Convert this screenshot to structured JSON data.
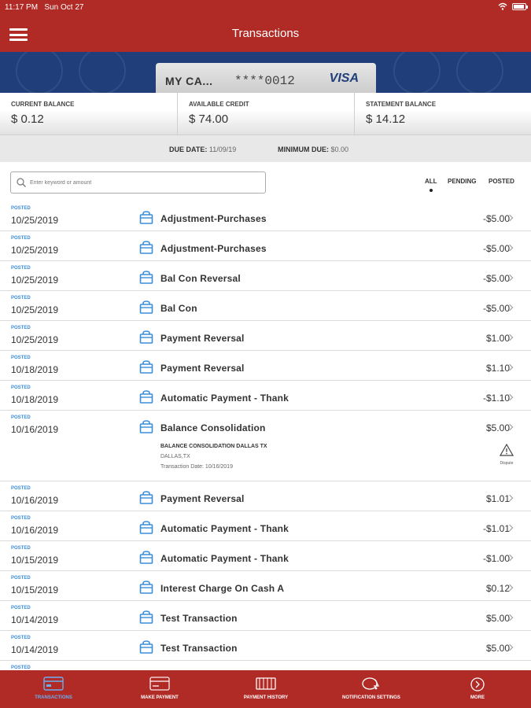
{
  "status_bar": {
    "time": "11:17 PM",
    "date": "Sun Oct 27"
  },
  "header": {
    "title": "Transactions"
  },
  "card": {
    "name": "MY CA...",
    "number": "****0012",
    "network": "VISA"
  },
  "balances": [
    {
      "label": "CURRENT BALANCE",
      "value": "$ 0.12"
    },
    {
      "label": "AVAILABLE CREDIT",
      "value": "$ 74.00"
    },
    {
      "label": "STATEMENT BALANCE",
      "value": "$ 14.12"
    }
  ],
  "due": {
    "due_label": "DUE DATE:",
    "due_value": "11/09/19",
    "min_label": "MINIMUM DUE:",
    "min_value": "$0.00"
  },
  "search": {
    "placeholder": "Enter keyword or amount"
  },
  "filters": {
    "all": "ALL",
    "pending": "PENDING",
    "posted": "POSTED",
    "selected": "ALL"
  },
  "transactions": [
    {
      "status": "POSTED",
      "date": "10/25/2019",
      "description": "Adjustment-Purchases",
      "amount": "-$5.00"
    },
    {
      "status": "POSTED",
      "date": "10/25/2019",
      "description": "Adjustment-Purchases",
      "amount": "-$5.00"
    },
    {
      "status": "POSTED",
      "date": "10/25/2019",
      "description": "Bal Con Reversal",
      "amount": "-$5.00"
    },
    {
      "status": "POSTED",
      "date": "10/25/2019",
      "description": "Bal Con",
      "amount": "-$5.00"
    },
    {
      "status": "POSTED",
      "date": "10/25/2019",
      "description": "Payment Reversal",
      "amount": "$1.00"
    },
    {
      "status": "POSTED",
      "date": "10/18/2019",
      "description": "Payment Reversal",
      "amount": "$1.10"
    },
    {
      "status": "POSTED",
      "date": "10/18/2019",
      "description": "Automatic Payment - Thank",
      "amount": "-$1.10"
    },
    {
      "status": "POSTED",
      "date": "10/16/2019",
      "description": "Balance Consolidation",
      "amount": "$5.00",
      "detail_merchant": "BALANCE CONSOLIDATION DALLAS TX",
      "detail_location": "DALLAS,TX",
      "detail_date": "Transaction Date: 10/16/2019",
      "dispute_label": "Dispute"
    },
    {
      "status": "POSTED",
      "date": "10/16/2019",
      "description": "Payment Reversal",
      "amount": "$1.01"
    },
    {
      "status": "POSTED",
      "date": "10/16/2019",
      "description": "Automatic Payment - Thank",
      "amount": "-$1.01"
    },
    {
      "status": "POSTED",
      "date": "10/15/2019",
      "description": "Automatic Payment - Thank",
      "amount": "-$1.00"
    },
    {
      "status": "POSTED",
      "date": "10/15/2019",
      "description": "Interest Charge On Cash A",
      "amount": "$0.12"
    },
    {
      "status": "POSTED",
      "date": "10/14/2019",
      "description": "Test Transaction",
      "amount": "$5.00"
    },
    {
      "status": "POSTED",
      "date": "10/14/2019",
      "description": "Test Transaction",
      "amount": "$5.00"
    },
    {
      "status": "POSTED",
      "date": "",
      "description": "",
      "amount": ""
    }
  ],
  "tabs": [
    {
      "label": "TRANSACTIONS",
      "icon": "card-icon",
      "active": true
    },
    {
      "label": "MAKE PAYMENT",
      "icon": "payment-icon",
      "active": false
    },
    {
      "label": "PAYMENT HISTORY",
      "icon": "history-icon",
      "active": false
    },
    {
      "label": "NOTIFICATION SETTINGS",
      "icon": "chat-bell-icon",
      "active": false
    },
    {
      "label": "MORE",
      "icon": "more-icon",
      "active": false
    }
  ],
  "colors": {
    "brand_red": "#b02a26",
    "banner_blue": "#1f3e7a",
    "accent_blue": "#3a8dd8"
  }
}
